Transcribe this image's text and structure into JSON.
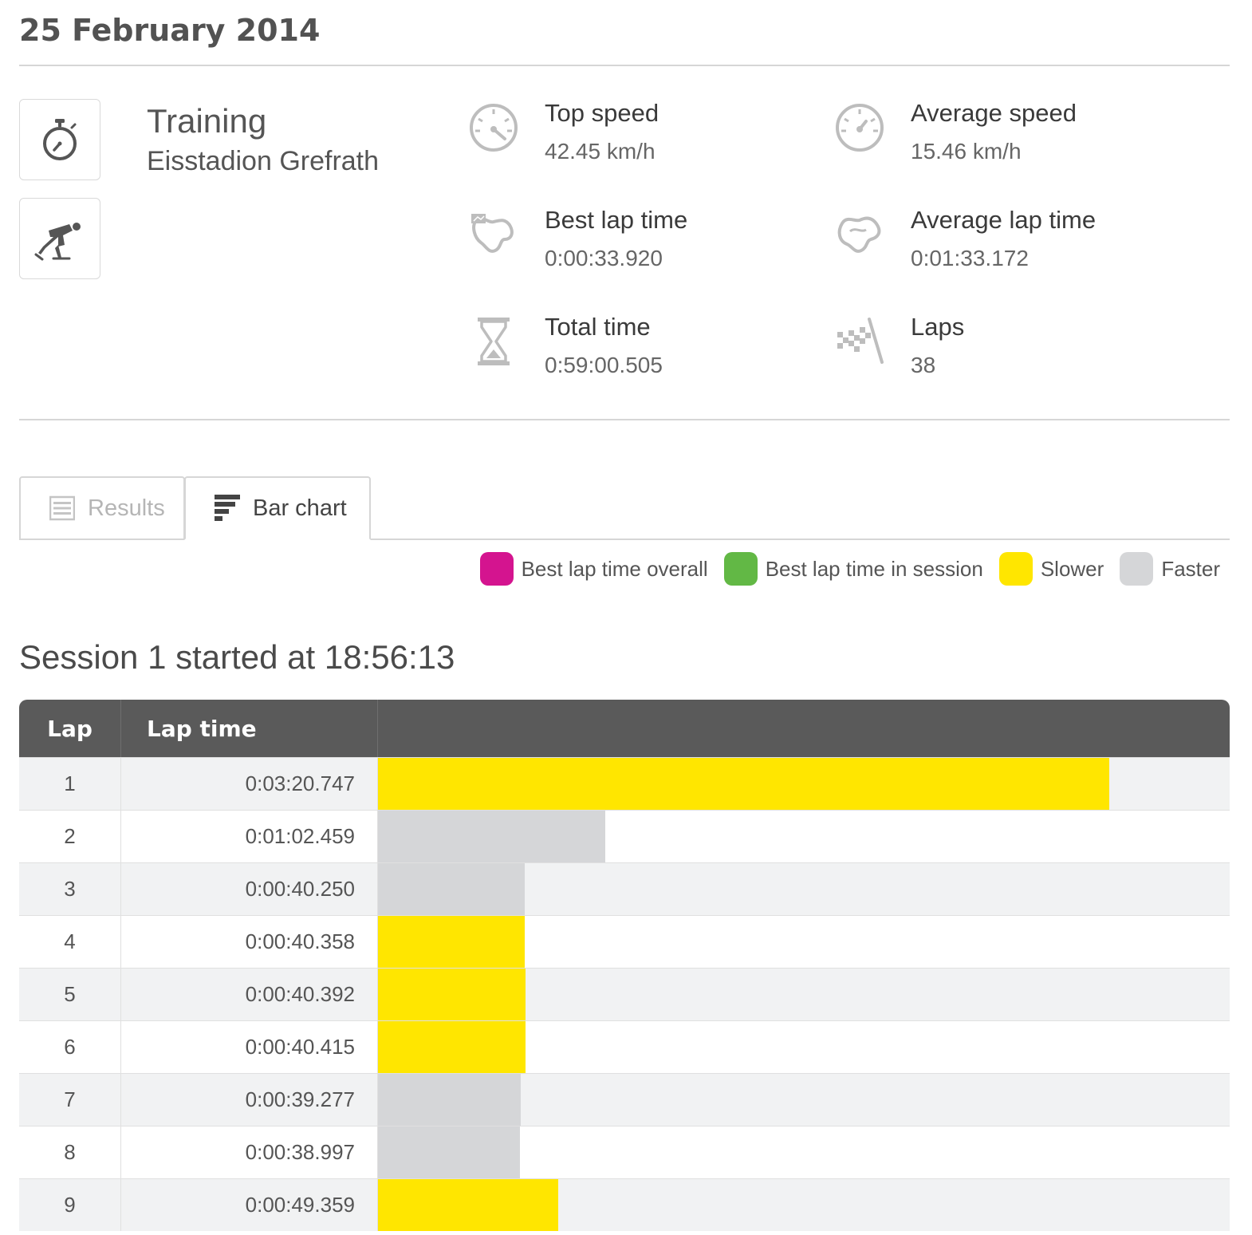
{
  "header": {
    "date": "25 February 2014"
  },
  "activity": {
    "type": "Training",
    "location": "Eisstadion Grefrath"
  },
  "stats": {
    "top_speed": {
      "label": "Top speed",
      "value": "42.45 km/h"
    },
    "average_speed": {
      "label": "Average speed",
      "value": "15.46 km/h"
    },
    "best_lap_time": {
      "label": "Best lap time",
      "value": "0:00:33.920"
    },
    "average_lap_time": {
      "label": "Average lap time",
      "value": "0:01:33.172"
    },
    "total_time": {
      "label": "Total time",
      "value": "0:59:00.505"
    },
    "laps": {
      "label": "Laps",
      "value": "38"
    }
  },
  "tabs": {
    "results": "Results",
    "bar_chart": "Bar chart",
    "active": "bar_chart"
  },
  "legend": {
    "best_overall": {
      "label": "Best lap time overall",
      "color": "#d4148f"
    },
    "best_session": {
      "label": "Best lap time in session",
      "color": "#62b845"
    },
    "slower": {
      "label": "Slower",
      "color": "#ffe600"
    },
    "faster": {
      "label": "Faster",
      "color": "#d5d6d8"
    }
  },
  "session": {
    "title": "Session 1 started at 18:56:13",
    "columns": {
      "lap": "Lap",
      "lap_time": "Lap time"
    },
    "laps": [
      {
        "lap": "1",
        "time": "0:03:20.747",
        "seconds": 200.747,
        "status": "slower"
      },
      {
        "lap": "2",
        "time": "0:01:02.459",
        "seconds": 62.459,
        "status": "faster"
      },
      {
        "lap": "3",
        "time": "0:00:40.250",
        "seconds": 40.25,
        "status": "faster"
      },
      {
        "lap": "4",
        "time": "0:00:40.358",
        "seconds": 40.358,
        "status": "slower"
      },
      {
        "lap": "5",
        "time": "0:00:40.392",
        "seconds": 40.392,
        "status": "slower"
      },
      {
        "lap": "6",
        "time": "0:00:40.415",
        "seconds": 40.415,
        "status": "slower"
      },
      {
        "lap": "7",
        "time": "0:00:39.277",
        "seconds": 39.277,
        "status": "faster"
      },
      {
        "lap": "8",
        "time": "0:00:38.997",
        "seconds": 38.997,
        "status": "faster"
      },
      {
        "lap": "9",
        "time": "0:00:49.359",
        "seconds": 49.359,
        "status": "slower"
      }
    ]
  }
}
